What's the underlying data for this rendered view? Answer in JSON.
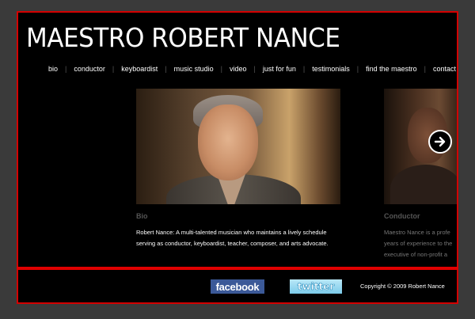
{
  "header": {
    "title": "MAESTRO ROBERT NANCE"
  },
  "nav": {
    "items": [
      {
        "label": "bio"
      },
      {
        "label": "conductor"
      },
      {
        "label": "keyboardist"
      },
      {
        "label": "music studio"
      },
      {
        "label": "video"
      },
      {
        "label": "just for fun"
      },
      {
        "label": "testimonials"
      },
      {
        "label": "find the maestro"
      },
      {
        "label": "contact"
      }
    ]
  },
  "slides": [
    {
      "heading": "Bio",
      "text": "Robert Nance: A multi-talented musician who maintains a lively schedule serving as conductor, keyboardist, teacher, composer, and arts advocate."
    },
    {
      "heading": "Conductor",
      "lines": [
        "Maestro Nance is a profe",
        "years of experience to the",
        "executive of non-profit a"
      ]
    }
  ],
  "footer": {
    "facebook_label": "facebook",
    "twitter_label": "twitter",
    "copyright": "Copyright © 2009 Robert Nance"
  },
  "colors": {
    "border": "#d40000",
    "background": "#000000",
    "facebook": "#3b5998",
    "twitter": "#7ccbea"
  },
  "icons": {
    "next": "arrow-right-circle-icon"
  }
}
